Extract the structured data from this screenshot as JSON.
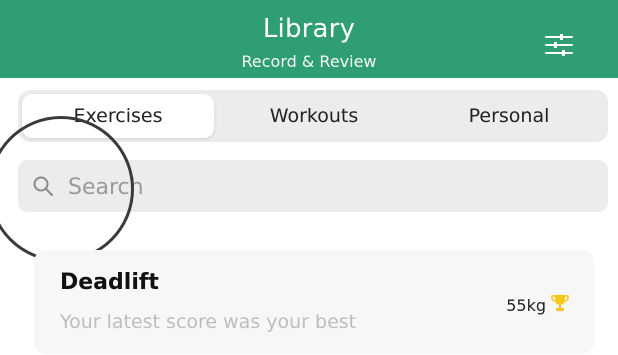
{
  "header": {
    "title": "Library",
    "subtitle": "Record & Review",
    "filter_icon": "sliders-icon",
    "color": "#2f9e73"
  },
  "tabs": [
    {
      "label": "Exercises",
      "active": true
    },
    {
      "label": "Workouts",
      "active": false
    },
    {
      "label": "Personal",
      "active": false
    }
  ],
  "search": {
    "placeholder": "Search",
    "value": "",
    "icon": "search-icon"
  },
  "exercises": [
    {
      "name": "Deadlift",
      "description": "Your latest score was your best",
      "score": "55kg",
      "icon": "trophy-icon",
      "icon_color": "#f5c518"
    }
  ]
}
